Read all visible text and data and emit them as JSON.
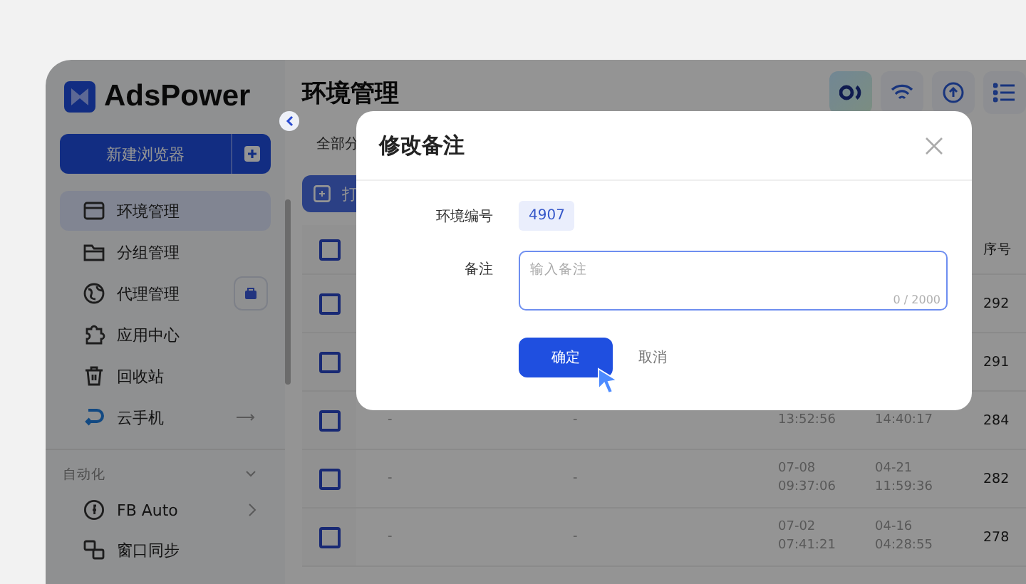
{
  "sidebar": {
    "logo": "AdsPower",
    "new_button": "新建浏览器",
    "items": [
      {
        "label": "环境管理",
        "selected": true
      },
      {
        "label": "分组管理",
        "selected": false
      },
      {
        "label": "代理管理",
        "selected": false
      },
      {
        "label": "应用中心",
        "selected": false
      },
      {
        "label": "回收站",
        "selected": false
      },
      {
        "label": "云手机",
        "selected": false
      }
    ],
    "section": {
      "label": "自动化",
      "expanded": true,
      "items": [
        {
          "label": "FB Auto",
          "selected": false
        },
        {
          "label": "窗口同步",
          "selected": false
        }
      ]
    }
  },
  "main": {
    "title": "环境管理",
    "tab": "全部分",
    "toolbar_button": "打",
    "table": {
      "all_checked": false,
      "columns": [
        "",
        "",
        "",
        "",
        "序号"
      ],
      "rows": [
        {
          "checked": false,
          "cells": [
            "",
            "",
            "",
            "",
            "292"
          ]
        },
        {
          "checked": false,
          "cells": [
            "",
            "",
            "",
            "",
            "291"
          ]
        },
        {
          "checked": false,
          "cells": [
            "-",
            "-",
            "13:52:56",
            "14:40:17",
            "284"
          ]
        },
        {
          "checked": false,
          "cells": [
            "-",
            "-",
            "07-08\n09:37:06",
            "04-21 11:59:36",
            "282"
          ]
        },
        {
          "checked": false,
          "cells": [
            "-",
            "-",
            "07-02\n07:41:21",
            "04-16\n04:28:55",
            "278"
          ]
        }
      ]
    }
  },
  "dialog": {
    "title": "修改备注",
    "id_label": "环境编号",
    "id_value": "4907",
    "note_label": "备注",
    "note": {
      "placeholder": "输入备注",
      "counter": "0 / 2000"
    },
    "confirm": "确定",
    "cancel": "取消"
  }
}
